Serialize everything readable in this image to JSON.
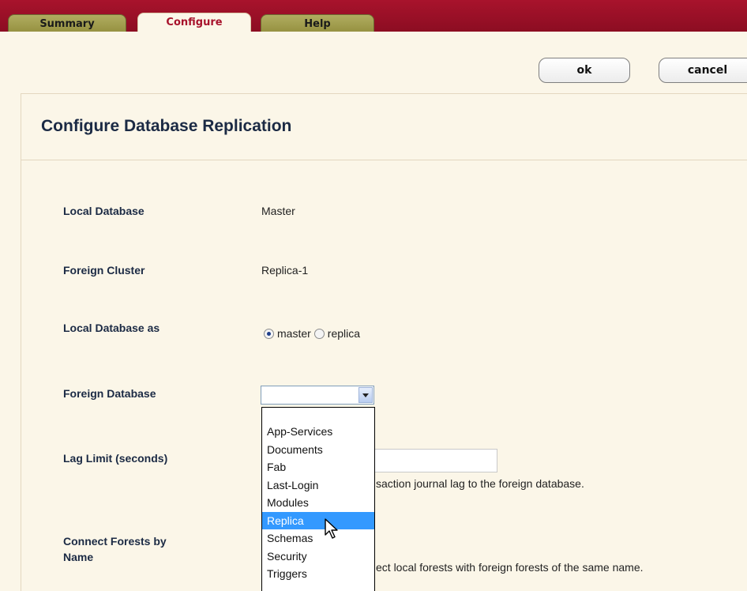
{
  "tabs": [
    {
      "label": "Summary",
      "state": "inactive"
    },
    {
      "label": "Configure",
      "state": "active"
    },
    {
      "label": "Help",
      "state": "inactive"
    }
  ],
  "toolbar": {
    "ok_label": "ok",
    "cancel_label": "cancel"
  },
  "page": {
    "title": "Configure Database Replication"
  },
  "fields": {
    "local_database": {
      "label": "Local Database",
      "value": "Master"
    },
    "foreign_cluster": {
      "label": "Foreign Cluster",
      "value": "Replica-1"
    },
    "local_database_as": {
      "label": "Local Database as",
      "options": [
        "master",
        "replica"
      ],
      "selected": "master"
    },
    "foreign_database": {
      "label": "Foreign Database",
      "value": "",
      "options": [
        "App-Services",
        "Documents",
        "Fab",
        "Last-Login",
        "Modules",
        "Replica",
        "Schemas",
        "Security",
        "Triggers"
      ],
      "highlighted": "Replica"
    },
    "lag_limit": {
      "label": "Lag Limit (seconds)",
      "value": "",
      "help_visible": "saction journal lag to the foreign database."
    },
    "connect_forests": {
      "label_line1": "Connect Forests by",
      "label_line2": "Name",
      "help_visible": "ect local forests with foreign forests of the same name."
    }
  },
  "colors": {
    "header_maroon": "#a8132c",
    "tab_olive": "#948f3e",
    "panel_bg": "#fbf6e8",
    "label_navy": "#1b2a44",
    "selection_blue": "#3399ff"
  },
  "icons": {
    "dropdown_arrow": "chevron-down-icon",
    "pointer": "mouse-pointer-icon"
  }
}
